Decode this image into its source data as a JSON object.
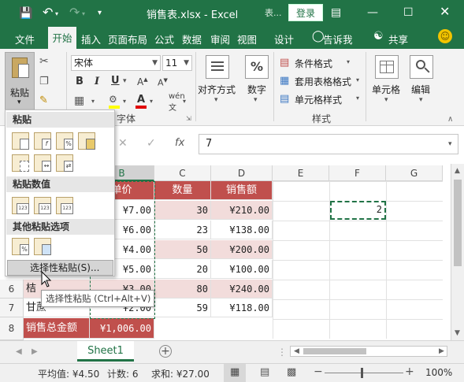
{
  "titlebar": {
    "file_title": "销售表.xlsx - Excel",
    "context_label": "表...",
    "login": "登录",
    "icons": [
      "save-icon",
      "undo-icon",
      "redo-icon",
      "customize-qat-icon",
      "ribbon-display-icon",
      "minimize-icon",
      "maximize-icon",
      "close-icon"
    ]
  },
  "tabs": {
    "file": "文件",
    "home": "开始",
    "insert": "插入",
    "page_layout": "页面布局",
    "formulas": "公式",
    "data": "数据",
    "review": "审阅",
    "view": "视图",
    "design": "设计",
    "tell_me": "告诉我",
    "share": "共享"
  },
  "ribbon": {
    "paste": "粘贴",
    "font_name": "宋体",
    "font_size": "11",
    "font_group": "字体",
    "bold": "B",
    "italic": "I",
    "underline": "U",
    "phonetic": "wén",
    "alignment": "对齐方式",
    "number": "数字",
    "number_icon": "%",
    "conditional_format": "条件格式",
    "table_format": "套用表格格式",
    "cell_styles": "单元格样式",
    "styles_group": "样式",
    "cells": "单元格",
    "editing": "编辑"
  },
  "formula_bar": {
    "value": "7",
    "fx": "fx",
    "cancel": "✕",
    "enter": "✓"
  },
  "columns": [
    "B",
    "C",
    "D",
    "E",
    "F",
    "G"
  ],
  "rows": [
    "6",
    "7",
    "8"
  ],
  "table": {
    "headers": {
      "price": "单价",
      "qty": "数量",
      "sales": "销售额"
    },
    "price_col": [
      "¥7.00",
      "¥6.00",
      "¥4.00",
      "¥5.00",
      "¥3.00",
      "¥2.00"
    ],
    "qty_col": [
      "30",
      "23",
      "50",
      "20",
      "80",
      "59"
    ],
    "sales_col": [
      "¥210.00",
      "¥138.00",
      "¥200.00",
      "¥100.00",
      "¥240.00",
      "¥118.00"
    ],
    "row6_name": "桔",
    "row7_name": "甘蔗",
    "total_label": "销售总金额",
    "total_value": "¥1,006.00"
  },
  "f3_value": "2",
  "paste_menu": {
    "sec_paste": "粘贴",
    "sec_values": "粘贴数值",
    "sec_other": "其他粘贴选项",
    "special": "选择性粘贴(S)...",
    "icons_paste": [
      "paste-icon",
      "paste-formulas-icon",
      "paste-formulas-number-format-icon",
      "keep-source-formatting-icon",
      "no-borders-icon",
      "keep-column-widths-icon",
      "transpose-icon"
    ],
    "icons_values": [
      "paste-values-icon",
      "values-number-format-icon",
      "values-source-formatting-icon"
    ],
    "icons_other": [
      "paste-formatting-icon",
      "paste-link-icon"
    ],
    "value_badge": "123"
  },
  "tooltip": "选择性粘贴 (Ctrl+Alt+V)",
  "sheet_tab": "Sheet1",
  "status": {
    "average": "平均值: ¥4.50",
    "count": "计数: 6",
    "sum": "求和: ¥27.00",
    "zoom": "100%"
  },
  "colors": {
    "excel_green": "#217346",
    "header_red": "#c0504d",
    "band_pink": "#f2dcdb"
  }
}
